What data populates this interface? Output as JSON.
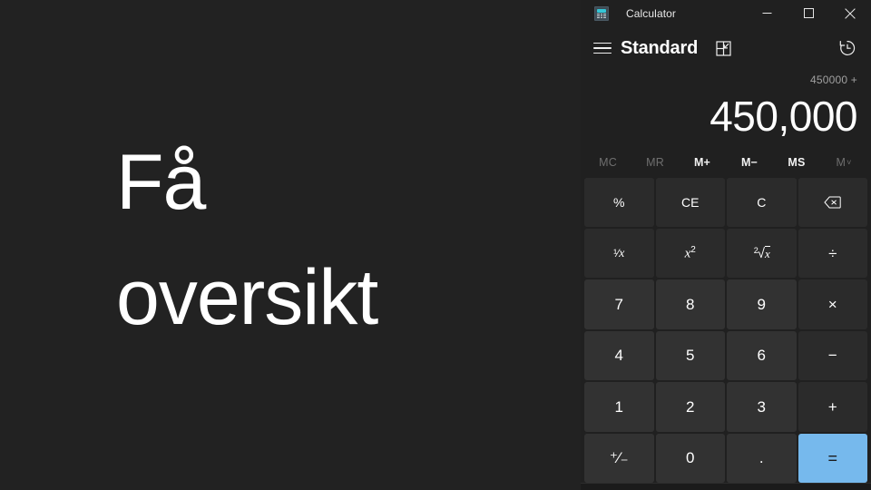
{
  "slide": {
    "heading": "Få\noversikt",
    "background_color": "#222222",
    "text_color": "#ffffff"
  },
  "calculator": {
    "titlebar": {
      "app_icon": "calculator-app-icon",
      "title": "Calculator",
      "minimize_label": "Minimize",
      "maximize_label": "Maximize",
      "close_label": "Close"
    },
    "header": {
      "menu_icon": "hamburger-menu-icon",
      "mode": "Standard",
      "keep_on_top_icon": "keep-on-top-icon",
      "history_icon": "history-clock-icon"
    },
    "display": {
      "expression": "450000 +",
      "result": "450,000"
    },
    "memory": [
      {
        "label": "MC",
        "enabled": false
      },
      {
        "label": "MR",
        "enabled": false
      },
      {
        "label": "M+",
        "enabled": true
      },
      {
        "label": "M−",
        "enabled": true
      },
      {
        "label": "MS",
        "enabled": true
      },
      {
        "label": "M",
        "enabled": false,
        "chevron": "˅"
      }
    ],
    "keys": [
      {
        "label": "%",
        "name": "percent-button",
        "kind": "fn"
      },
      {
        "label": "CE",
        "name": "clear-entry-button",
        "kind": "fn"
      },
      {
        "label": "C",
        "name": "clear-button",
        "kind": "fn"
      },
      {
        "label": "",
        "name": "backspace-button",
        "kind": "fn",
        "icon": "backspace-icon"
      },
      {
        "label": "",
        "name": "reciprocal-button",
        "kind": "fn",
        "rich": "reciprocal"
      },
      {
        "label": "",
        "name": "square-button",
        "kind": "fn",
        "rich": "square"
      },
      {
        "label": "",
        "name": "square-root-button",
        "kind": "fn",
        "rich": "sqrt"
      },
      {
        "label": "÷",
        "name": "divide-button",
        "kind": "op"
      },
      {
        "label": "7",
        "name": "seven-button",
        "kind": "num"
      },
      {
        "label": "8",
        "name": "eight-button",
        "kind": "num"
      },
      {
        "label": "9",
        "name": "nine-button",
        "kind": "num"
      },
      {
        "label": "×",
        "name": "multiply-button",
        "kind": "op"
      },
      {
        "label": "4",
        "name": "four-button",
        "kind": "num"
      },
      {
        "label": "5",
        "name": "five-button",
        "kind": "num"
      },
      {
        "label": "6",
        "name": "six-button",
        "kind": "num"
      },
      {
        "label": "−",
        "name": "subtract-button",
        "kind": "op"
      },
      {
        "label": "1",
        "name": "one-button",
        "kind": "num"
      },
      {
        "label": "2",
        "name": "two-button",
        "kind": "num"
      },
      {
        "label": "3",
        "name": "three-button",
        "kind": "num"
      },
      {
        "label": "+",
        "name": "add-button",
        "kind": "op"
      },
      {
        "label": "⁺⁄₋",
        "name": "sign-toggle-button",
        "kind": "num"
      },
      {
        "label": "0",
        "name": "zero-button",
        "kind": "num"
      },
      {
        "label": ".",
        "name": "decimal-button",
        "kind": "num"
      },
      {
        "label": "=",
        "name": "equals-button",
        "kind": "equals"
      }
    ],
    "colors": {
      "window_background": "#202020",
      "key_number": "#323232",
      "key_function": "#2b2b2b",
      "key_equals": "#76b9ed",
      "text_primary": "#ffffff",
      "text_secondary": "#a0a0a0",
      "text_disabled": "#6f6f6f"
    }
  }
}
